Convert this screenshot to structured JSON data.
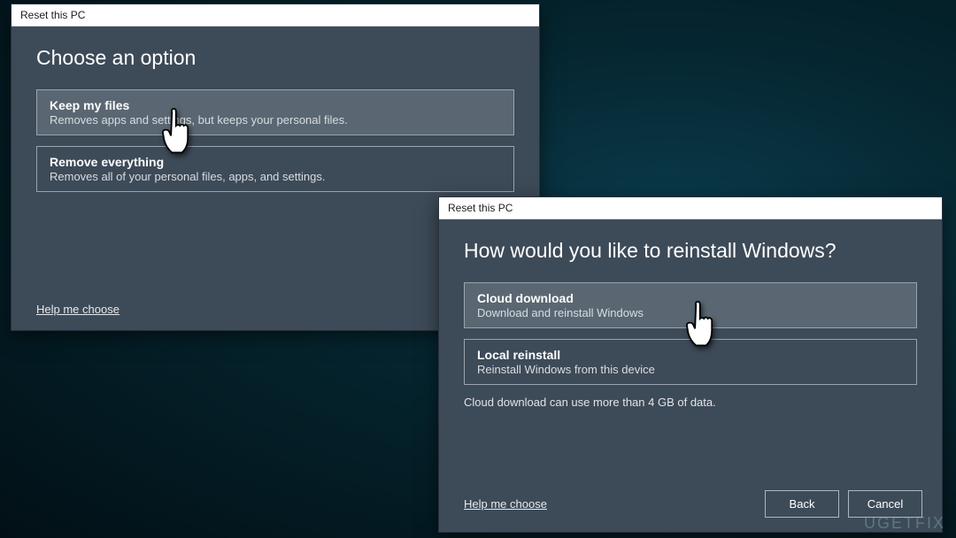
{
  "watermark": "UGETFIX",
  "dialog1": {
    "titlebar": "Reset this PC",
    "heading": "Choose an option",
    "options": [
      {
        "title": "Keep my files",
        "desc": "Removes apps and settings, but keeps your personal files."
      },
      {
        "title": "Remove everything",
        "desc": "Removes all of your personal files, apps, and settings."
      }
    ],
    "help": "Help me choose"
  },
  "dialog2": {
    "titlebar": "Reset this PC",
    "heading": "How would you like to reinstall Windows?",
    "options": [
      {
        "title": "Cloud download",
        "desc": "Download and reinstall Windows"
      },
      {
        "title": "Local reinstall",
        "desc": "Reinstall Windows from this device"
      }
    ],
    "note": "Cloud download can use more than 4 GB of data.",
    "help": "Help me choose",
    "back": "Back",
    "cancel": "Cancel"
  }
}
